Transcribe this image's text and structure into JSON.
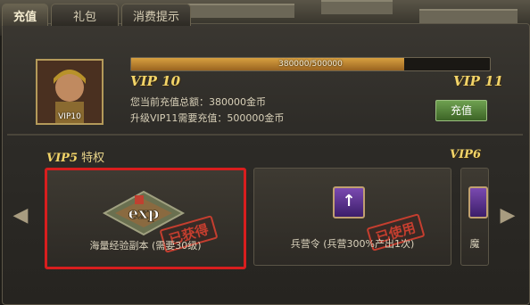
{
  "tabs": [
    {
      "label": "充值"
    },
    {
      "label": "礼包"
    },
    {
      "label": "消费提示"
    }
  ],
  "avatar": {
    "level_label": "VIP10"
  },
  "progress": {
    "text": "380000/500000",
    "current": 380000,
    "max": 500000
  },
  "vip_current": "VIP 10",
  "vip_next": "VIP 11",
  "info": {
    "total_recharge": "您当前充值总额：380000金币",
    "next_requirement": "升级VIP11需要充值：500000金币"
  },
  "buttons": {
    "recharge": "充值"
  },
  "section": {
    "vip": "VIP5",
    "suffix": "特权",
    "side_vip": "VIP6"
  },
  "cards": [
    {
      "label": "海量经验副本 (需要30级)",
      "stamp": "已获得",
      "icon": "exp-map-icon",
      "icon_text": "exp"
    },
    {
      "label": "兵营令 (兵营300%产出1次)",
      "stamp": "已使用",
      "icon": "barracks-token-icon",
      "icon_text": "↑"
    },
    {
      "label": "魔",
      "icon": "purple-item-icon"
    }
  ],
  "arrows": {
    "left": "◀",
    "right": "▶"
  },
  "colors": {
    "accent": "#f2d468",
    "highlight_border": "#d81e1e",
    "stamp": "#d24030",
    "button": "#4e8236"
  }
}
